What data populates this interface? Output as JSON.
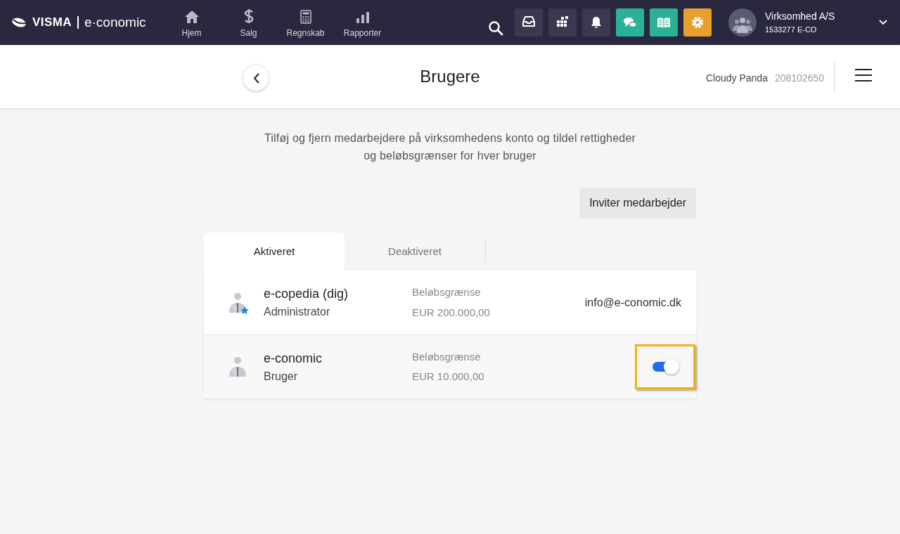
{
  "topbar": {
    "logo_brand": "VISMA",
    "logo_product": "e·conomic",
    "nav": [
      {
        "label": "Hjem"
      },
      {
        "label": "Salg"
      },
      {
        "label": "Regnskab"
      },
      {
        "label": "Rapporter"
      }
    ],
    "tools": [
      {
        "color": "#3a3950"
      },
      {
        "color": "#3a3950"
      },
      {
        "color": "#3a3950"
      },
      {
        "color": "#2bb196"
      },
      {
        "color": "#2bb196"
      },
      {
        "color": "#e99f2e"
      }
    ],
    "company": {
      "name": "Virksomhed A/S",
      "number": "1533277 E-CO"
    }
  },
  "header": {
    "title": "Brugere",
    "user_name": "Cloudy Panda",
    "user_id": "208102650"
  },
  "intro": [
    "Tilføj og fjern medarbejdere på virksomhedens konto og tildel rettigheder",
    "og beløbsgrænser for hver bruger"
  ],
  "invite_button": "Inviter medarbejder",
  "tabs": [
    {
      "label": "Aktiveret",
      "selected": true
    },
    {
      "label": "Deaktiveret",
      "selected": false
    }
  ],
  "users": [
    {
      "name": "e-copedia (dig)",
      "role": "Administrator",
      "admin": true,
      "limit_label": "Beløbsgrænse",
      "limit": "EUR 200.000,00",
      "kind": "email",
      "email": "info@e-conomic.dk"
    },
    {
      "name": "e-conomic",
      "role": "Bruger",
      "admin": false,
      "limit_label": "Beløbsgrænse",
      "limit": "EUR 10.000,00",
      "kind": "toggle",
      "on": true,
      "focused": true
    }
  ]
}
